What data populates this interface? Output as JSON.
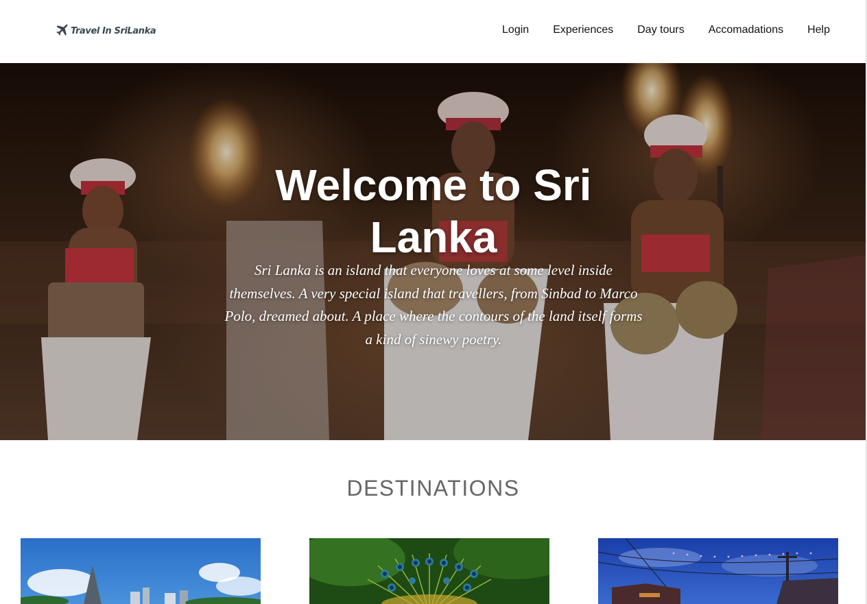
{
  "header": {
    "logo_text": "Travel In SriLanka",
    "logo_icon": "airplane-icon",
    "nav": [
      {
        "label": "Login"
      },
      {
        "label": "Experiences"
      },
      {
        "label": "Day tours"
      },
      {
        "label": "Accomadations"
      },
      {
        "label": "Help"
      }
    ]
  },
  "hero": {
    "title": "Welcome to Sri Lanka",
    "text": "Sri Lanka is an island that everyone loves at some level inside themselves. A very special island that travellers, from Sinbad to Marco Polo, dreamed about. A place where the contours of the land itself forms a kind of sinewy poetry."
  },
  "destinations": {
    "title": "DESTINATIONS",
    "cards": [
      {
        "image": "city-temple-skyline-photo"
      },
      {
        "image": "peacock-feathers-photo"
      },
      {
        "image": "night-street-lights-photo"
      }
    ]
  },
  "colors": {
    "nav_text": "#111111",
    "section_title": "#666666",
    "hero_text": "#ffffff",
    "logo_text": "#3a4652"
  }
}
